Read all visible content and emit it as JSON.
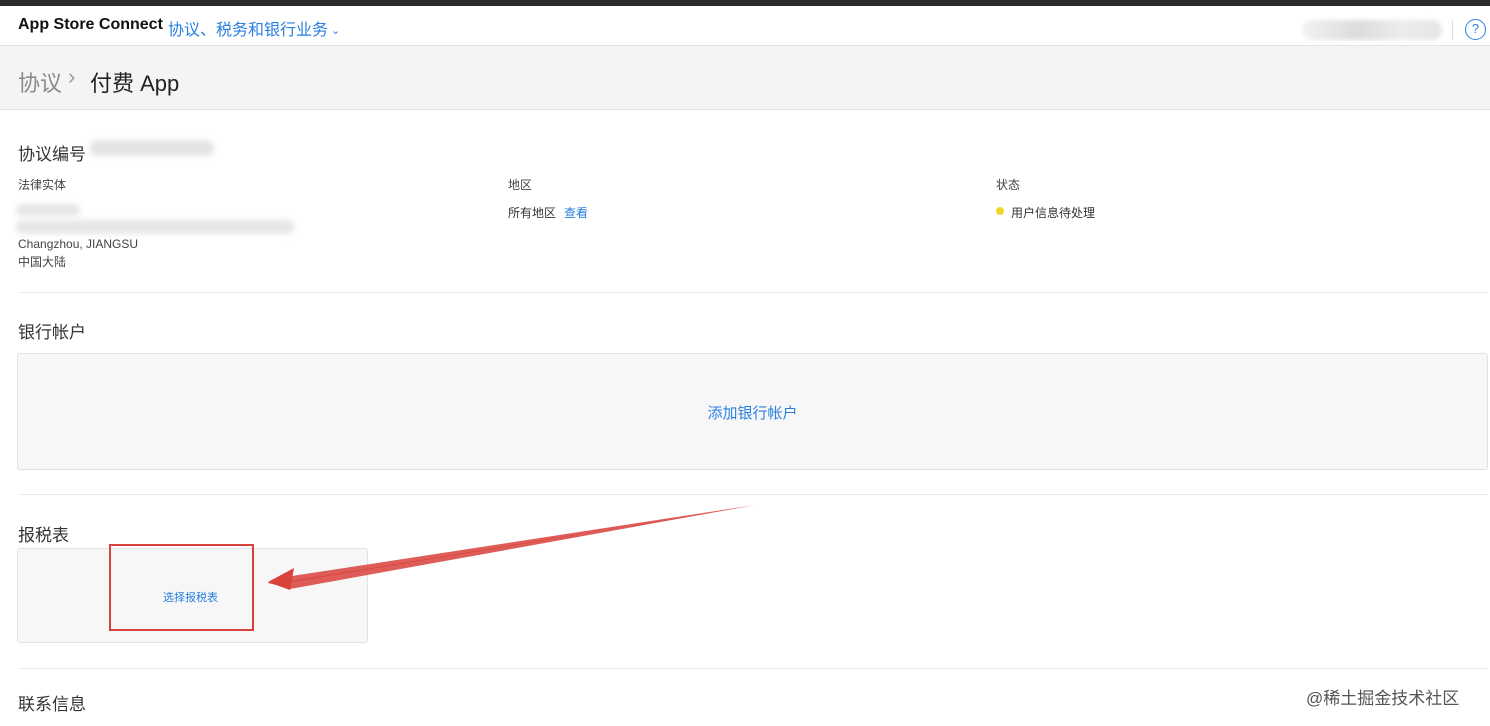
{
  "topbar": {
    "brand": "App Store Connect",
    "section": "协议、税务和银行业务",
    "help_symbol": "?"
  },
  "breadcrumb": {
    "parent": "协议",
    "separator": "›",
    "current": "付费 App"
  },
  "agreement": {
    "title": "协议编号",
    "legal_entity_label": "法律实体",
    "address_city": "Changzhou, JIANGSU",
    "address_country": "中国大陆",
    "region_label": "地区",
    "region_value": "所有地区",
    "region_view_link": "查看",
    "status_label": "状态",
    "status_value": "用户信息待处理",
    "status_color": "#f2d62e"
  },
  "bank": {
    "title": "银行帐户",
    "add_label": "添加银行帐户"
  },
  "tax": {
    "title": "报税表",
    "select_label": "选择报税表"
  },
  "contact": {
    "title": "联系信息"
  },
  "watermark": "@稀土掘金技术社区",
  "colors": {
    "accent": "#2a7fe0",
    "annotation": "#d9413b"
  }
}
